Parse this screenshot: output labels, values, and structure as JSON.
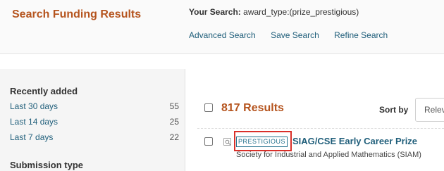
{
  "header": {
    "title": "Search Funding Results",
    "your_search_label": "Your Search:",
    "your_search_value": "award_type:(prize_prestigious)",
    "actions": [
      "Advanced Search",
      "Save Search",
      "Refine Search"
    ]
  },
  "sidebar": {
    "recently_added": {
      "heading": "Recently added",
      "items": [
        {
          "label": "Last 30 days",
          "count": "55"
        },
        {
          "label": "Last 14 days",
          "count": "25"
        },
        {
          "label": "Last 7 days",
          "count": "22"
        }
      ]
    },
    "submission_type": {
      "heading": "Submission type"
    }
  },
  "results": {
    "count_label": "817 Results",
    "sort_label": "Sort by",
    "sort_value": "Relev",
    "items": [
      {
        "tag": "PRESTIGIOUS",
        "title": "SIAG/CSE Early Career Prize",
        "sponsor": "Society for Industrial and Applied Mathematics (SIAM)"
      }
    ]
  },
  "colors": {
    "accent": "#b5541e",
    "link": "#1f5e7a",
    "highlight": "#d9302a"
  }
}
